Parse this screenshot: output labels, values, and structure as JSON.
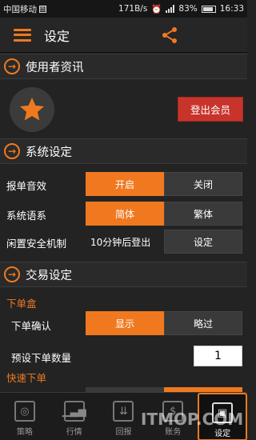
{
  "status_bar": {
    "carrier": "中国移动",
    "carrier_box": "图",
    "speed": "171B/s",
    "battery": "83%",
    "time": "16:33"
  },
  "app_bar": {
    "title": "设定",
    "menu_icon": "hamburger-icon",
    "share_icon": "share-icon",
    "accent": "#f07920"
  },
  "user_section": {
    "title": "使用者资讯",
    "avatar_icon": "star-icon",
    "logout_label": "登出会员",
    "logout_color": "#c8342b"
  },
  "system_section": {
    "title": "系统设定",
    "rows": [
      {
        "label": "报单音效",
        "options": [
          "开启",
          "关闭"
        ],
        "selected": 0
      },
      {
        "label": "系统语系",
        "options": [
          "简体",
          "繁体"
        ],
        "selected": 0
      },
      {
        "label": "闲置安全机制",
        "value": "10分钟后登出",
        "button": "设定"
      }
    ]
  },
  "trade_section": {
    "title": "交易设定",
    "order_box_heading": "下单盒",
    "confirm_label": "下单确认",
    "confirm_options": [
      "显示",
      "略过"
    ],
    "confirm_selected": 0,
    "qty_label": "预设下单数量",
    "qty_value": "1",
    "quick_heading": "快速下单"
  },
  "bottom_nav": [
    {
      "label": "策略",
      "icon": "target-icon"
    },
    {
      "label": "行情",
      "icon": "chart-icon"
    },
    {
      "label": "回报",
      "icon": "download-icon"
    },
    {
      "label": "账务",
      "icon": "dollar-icon"
    },
    {
      "label": "设定",
      "icon": "settings-icon",
      "active": true
    }
  ],
  "watermark": "ITMOP.COM"
}
